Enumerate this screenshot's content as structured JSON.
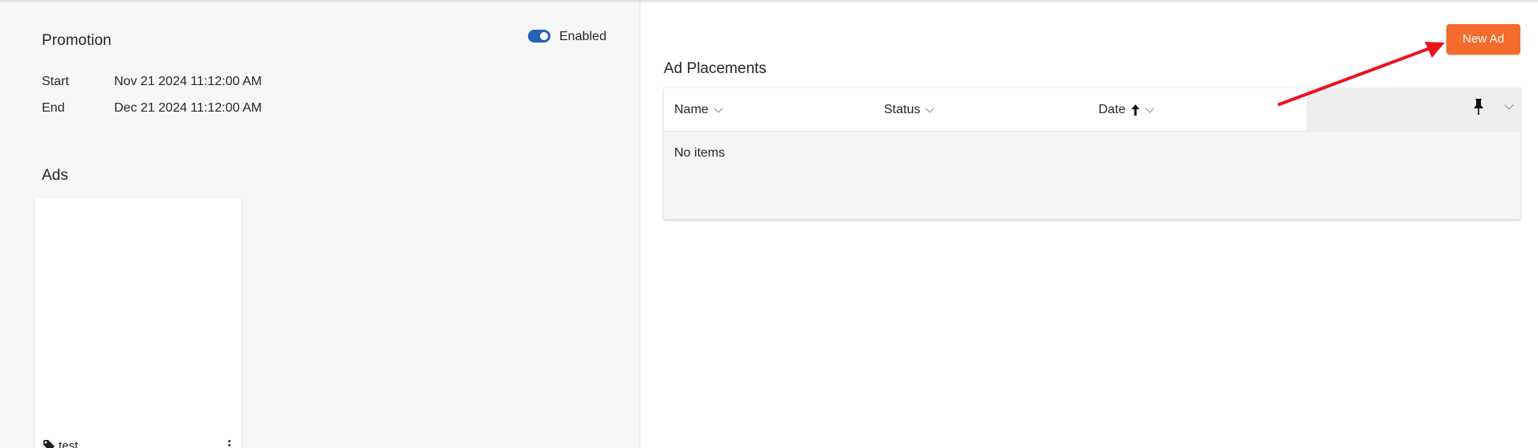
{
  "promotion": {
    "title": "Promotion",
    "toggle_label": "Enabled",
    "start_label": "Start",
    "start_value": "Nov 21 2024 11:12:00 AM",
    "end_label": "End",
    "end_value": "Dec 21 2024 11:12:00 AM"
  },
  "ads": {
    "title": "Ads",
    "cards": [
      {
        "name": "test",
        "icon": "tag-icon"
      }
    ]
  },
  "placements": {
    "new_ad_label": "New Ad",
    "title": "Ad Placements",
    "columns": [
      {
        "label": "Name"
      },
      {
        "label": "Status"
      },
      {
        "label": "Date",
        "sort": "ascending"
      }
    ],
    "empty_text": "No items"
  },
  "colors": {
    "accent_button": "#f46b2b",
    "toggle_on": "#2463b4",
    "annotation_arrow": "#e8141b"
  }
}
